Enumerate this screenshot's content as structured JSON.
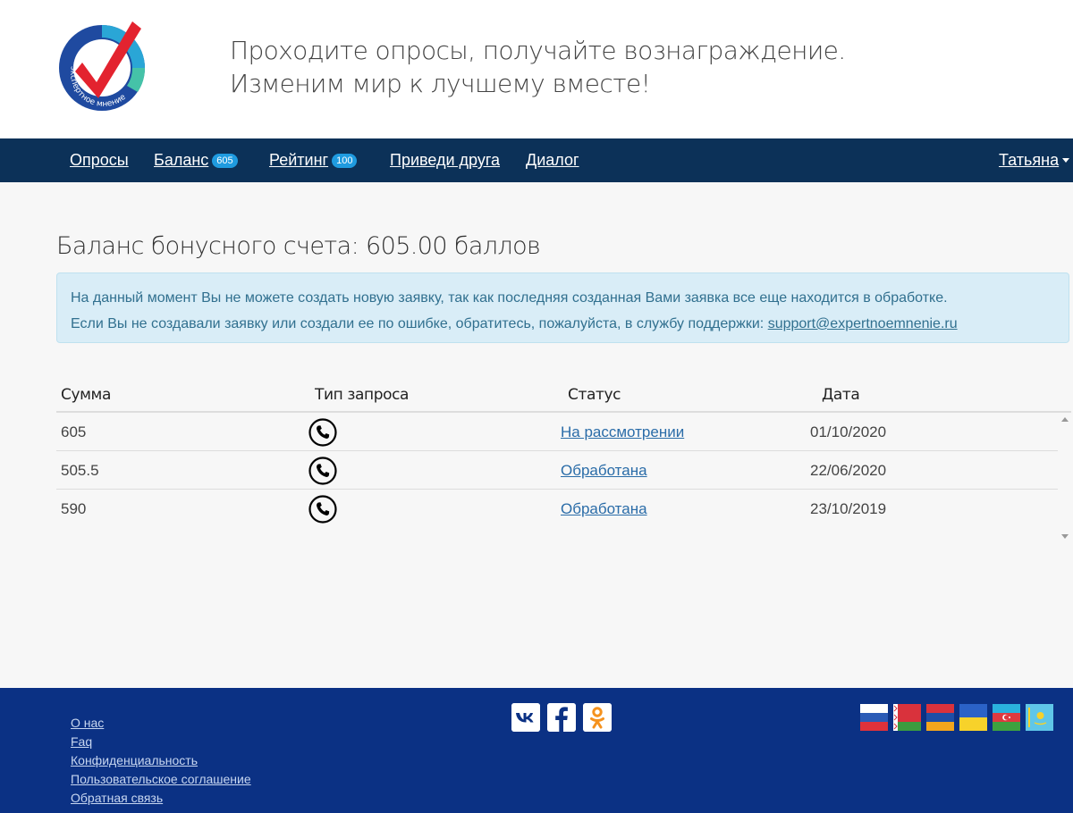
{
  "header": {
    "logo_text": "экспертное мнение",
    "tagline_line1": "Проходите опросы, получайте вознаграждение.",
    "tagline_line2": "Изменим мир к лучшему вместе!"
  },
  "nav": {
    "items": [
      {
        "label": "Опросы"
      },
      {
        "label": "Баланс",
        "badge": "605"
      },
      {
        "label": "Рейтинг",
        "badge": "100"
      },
      {
        "label": "Приведи друга"
      },
      {
        "label": "Диалог"
      }
    ],
    "user": "Татьяна"
  },
  "page": {
    "title": "Баланс бонусного счета: 605.00 баллов"
  },
  "alert": {
    "line1": "На данный момент Вы не можете создать новую заявку, так как последняя созданная Вами заявка все еще находится в обработке.",
    "line2_prefix": "Если Вы не создавали заявку или создали ее по ошибке, обратитесь, пожалуйста, в службу поддержки: ",
    "email": "support@expertnoemnenie.ru"
  },
  "table": {
    "headers": [
      "Сумма",
      "Тип запроса",
      "Статус",
      "Дата"
    ],
    "rows": [
      {
        "amount": "605",
        "type_icon": "phone-icon",
        "status": "На рассмотрении",
        "date": "01/10/2020"
      },
      {
        "amount": "505.5",
        "type_icon": "phone-icon",
        "status": "Обработана",
        "date": "22/06/2020"
      },
      {
        "amount": "590",
        "type_icon": "phone-icon",
        "status": "Обработана",
        "date": "23/10/2019"
      }
    ]
  },
  "footer": {
    "links": [
      "О нас",
      "Faq",
      "Конфиденциальность",
      "Пользовательское соглашение",
      "Обратная связь"
    ],
    "social_icons": [
      "vk-icon",
      "facebook-icon",
      "odnoklassniki-icon"
    ],
    "flags": [
      "russia-flag-icon",
      "belarus-flag-icon",
      "armenia-flag-icon",
      "ukraine-flag-icon",
      "azerbaijan-flag-icon",
      "kazakhstan-flag-icon"
    ]
  },
  "colors": {
    "navbar": "#0c3158",
    "footer": "#0b3184",
    "badge": "#1f9be0",
    "alert_bg": "#d9edf7",
    "alert_text": "#31708f",
    "link": "#2a6ca8",
    "logo_red": "#e3232f"
  }
}
